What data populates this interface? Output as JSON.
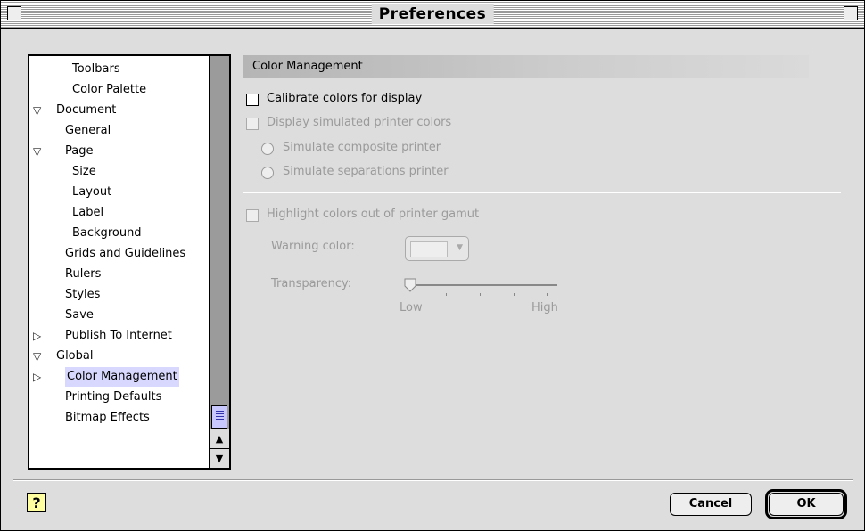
{
  "window": {
    "title": "Preferences"
  },
  "tree": {
    "items": [
      {
        "label": "Toolbars",
        "indent": 2,
        "expander": "none"
      },
      {
        "label": "Color Palette",
        "indent": 2,
        "expander": "none"
      },
      {
        "label": "Document",
        "indent": 0,
        "expander": "expanded"
      },
      {
        "label": "General",
        "indent": 1,
        "expander": "none"
      },
      {
        "label": "Page",
        "indent": 1,
        "expander": "expanded"
      },
      {
        "label": "Size",
        "indent": 2,
        "expander": "none"
      },
      {
        "label": "Layout",
        "indent": 2,
        "expander": "none"
      },
      {
        "label": "Label",
        "indent": 2,
        "expander": "none"
      },
      {
        "label": "Background",
        "indent": 2,
        "expander": "none"
      },
      {
        "label": "Grids and Guidelines",
        "indent": 1,
        "expander": "none"
      },
      {
        "label": "Rulers",
        "indent": 1,
        "expander": "none"
      },
      {
        "label": "Styles",
        "indent": 1,
        "expander": "none"
      },
      {
        "label": "Save",
        "indent": 1,
        "expander": "none"
      },
      {
        "label": "Publish To Internet",
        "indent": 1,
        "expander": "collapsed"
      },
      {
        "label": "Global",
        "indent": 0,
        "expander": "expanded"
      },
      {
        "label": "Color Management",
        "indent": 1,
        "expander": "collapsed",
        "selected": true
      },
      {
        "label": "Printing Defaults",
        "indent": 1,
        "expander": "none"
      },
      {
        "label": "Bitmap Effects",
        "indent": 1,
        "expander": "none"
      }
    ]
  },
  "panel": {
    "header": "Color Management",
    "calibrate_label": "Calibrate colors for display",
    "simulated_label": "Display simulated printer colors",
    "composite_label": "Simulate composite printer",
    "separations_label": "Simulate separations printer",
    "gamut_label": "Highlight colors out of printer gamut",
    "warning_label": "Warning color:",
    "transparency_label": "Transparency:",
    "low_label": "Low",
    "high_label": "High"
  },
  "buttons": {
    "help_label": "?",
    "cancel_label": "Cancel",
    "ok_label": "OK"
  },
  "colors": {
    "selection": "#d8d8ff",
    "disabled_text": "#9a9a9a",
    "window_bg": "#dddddd"
  }
}
